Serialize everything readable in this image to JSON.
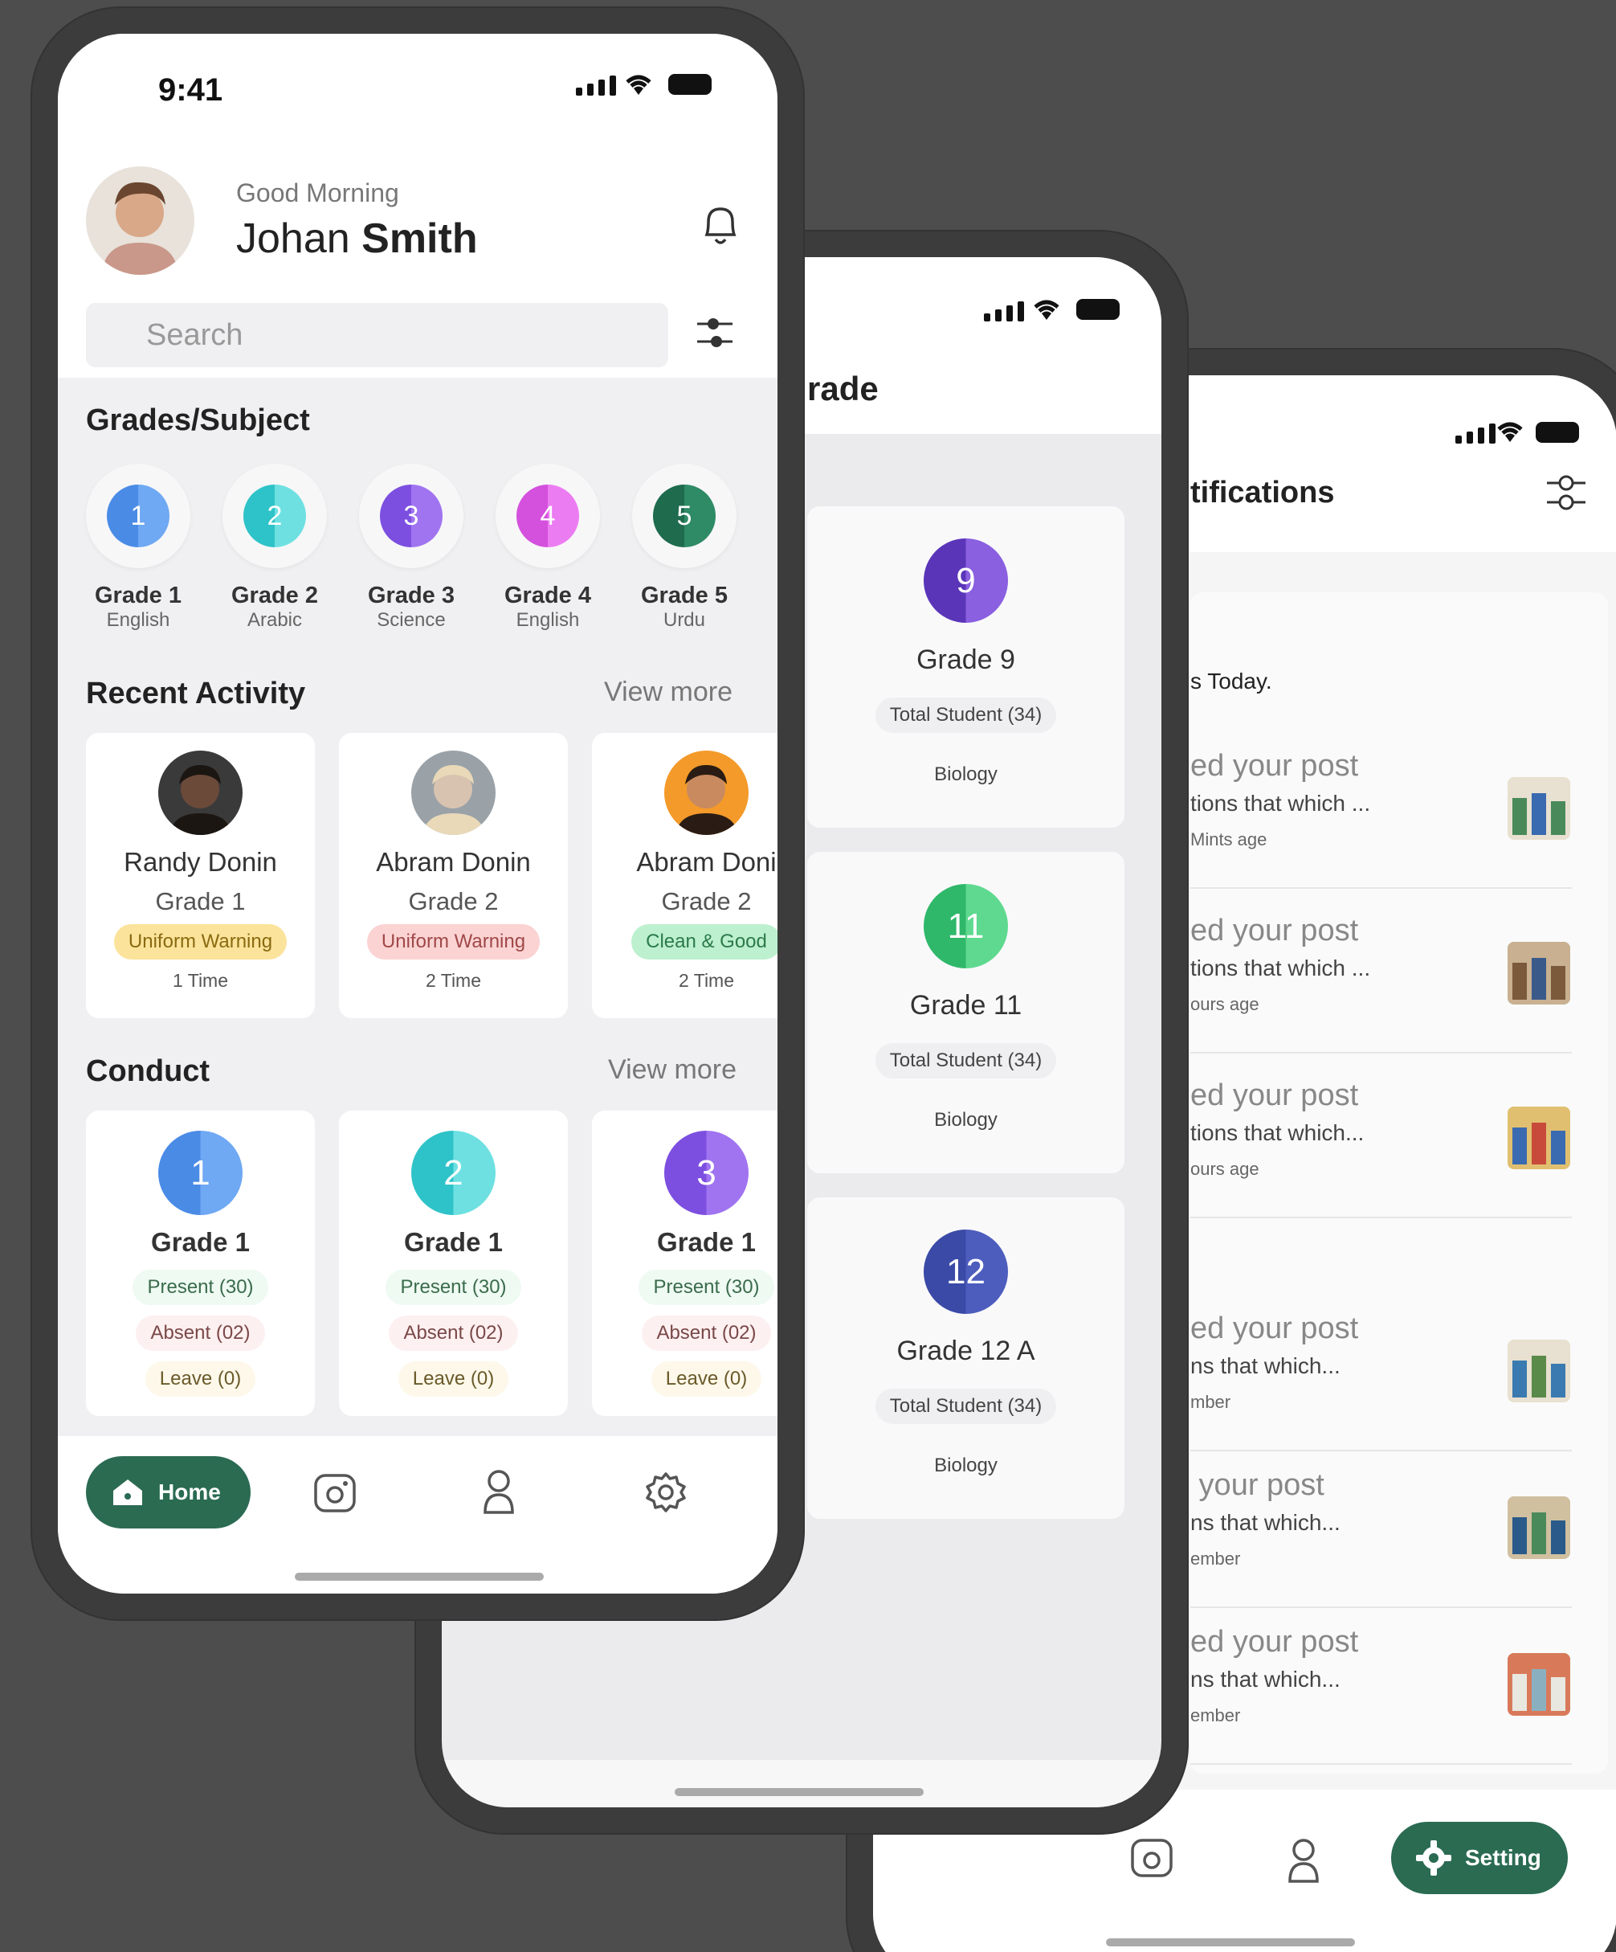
{
  "phone1": {
    "time": "9:41",
    "greeting": "Good Morning",
    "first_name": "Johan",
    "last_name": "Smith",
    "search_placeholder": "Search",
    "grades_title": "Grades/Subject",
    "grades": [
      {
        "num": "1",
        "label": "Grade 1",
        "subject": "English",
        "color": "#4a8be6",
        "light": "#6fa8f3"
      },
      {
        "num": "2",
        "label": "Grade 2",
        "subject": "Arabic",
        "color": "#2ec3c8",
        "light": "#6ee0e1"
      },
      {
        "num": "3",
        "label": "Grade 3",
        "subject": "Science",
        "color": "#7c4fe0",
        "light": "#a074f0"
      },
      {
        "num": "4",
        "label": "Grade 4",
        "subject": "English",
        "color": "#d451dd",
        "light": "#ec7cf1"
      },
      {
        "num": "5",
        "label": "Grade 5",
        "subject": "Urdu",
        "color": "#1f6b4d",
        "light": "#2f8b65"
      }
    ],
    "recent_title": "Recent Activity",
    "recent_more": "View more",
    "recent": [
      {
        "name": "Randy Donin",
        "grade": "Grade 1",
        "tag": "Uniform Warning",
        "times": "1 Time",
        "tag_bg": "#fbe39b",
        "tag_fg": "#8a6a10"
      },
      {
        "name": "Abram Donin",
        "grade": "Grade 2",
        "tag": "Uniform Warning",
        "times": "2 Time",
        "tag_bg": "#fbd3d3",
        "tag_fg": "#a04848"
      },
      {
        "name": "Abram Doni",
        "grade": "Grade 2",
        "tag": "Clean & Good",
        "times": "2 Time",
        "tag_bg": "#bdf0cf",
        "tag_fg": "#2c7a4a"
      }
    ],
    "conduct_title": "Conduct",
    "conduct_more": "View more",
    "conduct": [
      {
        "num": "1",
        "grade": "Grade 1",
        "present": "Present (30)",
        "absent": "Absent (02)",
        "leave": "Leave (0)",
        "color": "#4a8be6",
        "light": "#6fa8f3"
      },
      {
        "num": "2",
        "grade": "Grade 1",
        "present": "Present (30)",
        "absent": "Absent (02)",
        "leave": "Leave (0)",
        "color": "#2ec3c8",
        "light": "#6ee0e1"
      },
      {
        "num": "3",
        "grade": "Grade 1",
        "present": "Present (30)",
        "absent": "Absent (02)",
        "leave": "Leave (0)",
        "color": "#7c4fe0",
        "light": "#a074f0"
      }
    ],
    "nav_home": "Home"
  },
  "phone2": {
    "title_partial": "rade",
    "cards": [
      {
        "num": "9",
        "label": "Grade 9",
        "students": "Total Student (34)",
        "subject": "Biology",
        "color": "#5a35b8",
        "light": "#8a5fe0"
      },
      {
        "num": "11",
        "label": "Grade 11",
        "students": "Total Student (34)",
        "subject": "Biology",
        "color": "#2fb86a",
        "light": "#5fd98f"
      },
      {
        "num": "12",
        "label": "Grade 12 A",
        "students": "Total Student (34)",
        "subject": "Biology",
        "color": "#3a4aa6",
        "light": "#4d5dbd"
      }
    ]
  },
  "phone3": {
    "title_partial": "tifications",
    "section_today": "s Today.",
    "items": [
      {
        "title": "ed your post",
        "desc": "tions that which ...",
        "time": "Mints age"
      },
      {
        "title": "ed your post",
        "desc": "tions that which ...",
        "time": "ours age"
      },
      {
        "title": "ed your post",
        "desc": "tions that which...",
        "time": "ours age"
      },
      {
        "title": "ed your post",
        "desc": "ns that which...",
        "time": "mber"
      },
      {
        "title": " your post",
        "desc": "ns that which...",
        "time": "ember"
      },
      {
        "title": "ed your post",
        "desc": "ns that which...",
        "time": "ember"
      }
    ],
    "nav_setting": "Setting"
  },
  "colors": {
    "brand": "#2a6b52",
    "bg": "#4d4d4d"
  }
}
